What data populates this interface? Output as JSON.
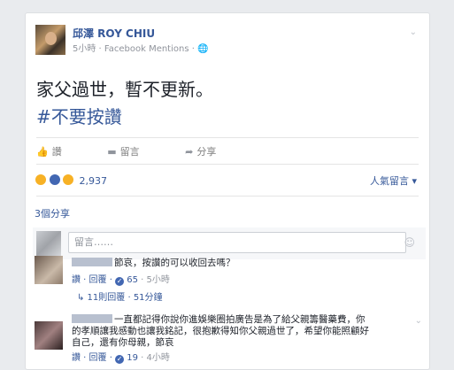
{
  "post": {
    "author": "邱澤 ROY CHIU",
    "meta": "5小時 · Facebook Mentions · 🌐",
    "text": "家父過世，暫不更新。",
    "hashtag": "#不要按讚"
  },
  "actions": {
    "like": "讚",
    "comment": "留言",
    "share": "分享"
  },
  "reactions": {
    "count": "2,937",
    "sort_label": "人氣留言 ▾",
    "shares": "3個分享"
  },
  "composer": {
    "placeholder": "留言……"
  },
  "comments": [
    {
      "text": "節哀，按讚的可以收回去嗎？",
      "actions": "讚 · 回覆 · ",
      "likes": "65",
      "time": " · 5小時",
      "replies": "↳ 11則回覆 · 51分鐘"
    },
    {
      "text_line1": "一直都記得你說你進娛樂圈拍廣告是為了給父親籌醫藥費，你",
      "text_line2": "的孝順讓我感動也讓我銘記，很抱歉得知你父親過世了，希望你能照顧好",
      "text_line3": "自己，還有你母親，節哀",
      "actions": "讚 · 回覆 · ",
      "likes": "19",
      "time": " · 4小時"
    }
  ],
  "colors": {
    "link": "#365899",
    "muted": "#90949c",
    "background": "#e9ebee"
  }
}
